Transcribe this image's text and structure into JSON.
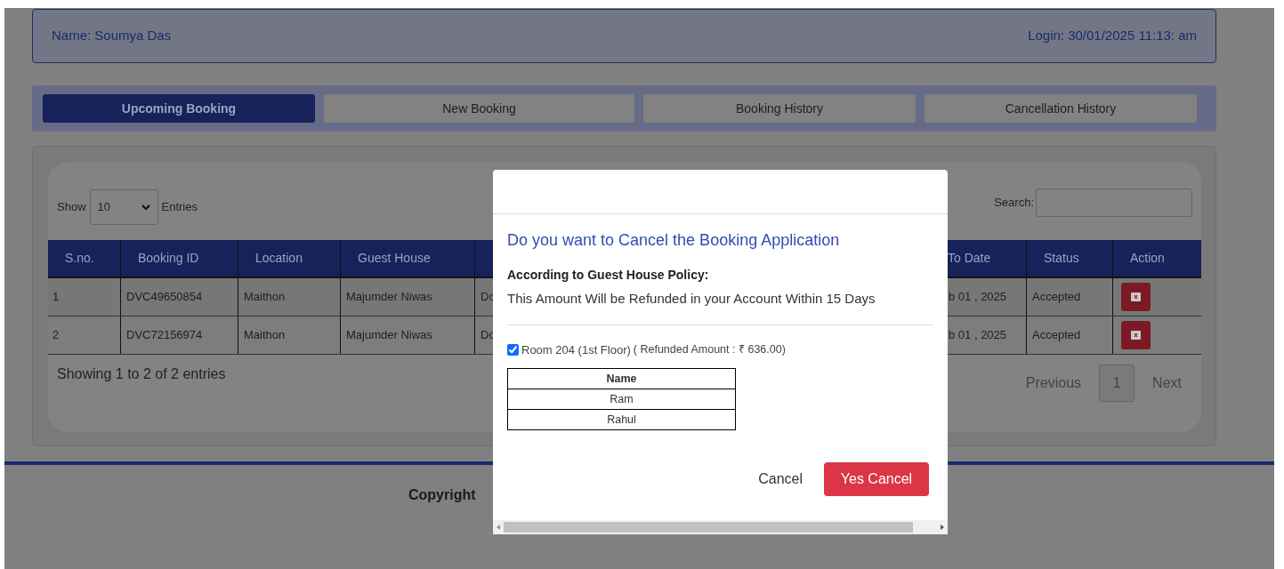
{
  "user_bar": {
    "name": "Name: Soumya Das",
    "login": "Login: 30/01/2025 11:13: am"
  },
  "tabs": [
    {
      "label": "Upcoming Booking",
      "selected": true
    },
    {
      "label": "New Booking",
      "selected": false
    },
    {
      "label": "Booking History",
      "selected": false
    },
    {
      "label": "Cancellation History",
      "selected": false
    }
  ],
  "table_controls": {
    "show_label": "Show",
    "page_size": "10",
    "entries_label": "Entries",
    "search_label": "Search:"
  },
  "table": {
    "columns": [
      "S.no.",
      "Booking ID",
      "Location",
      "Guest House",
      "",
      "To Date",
      "Status",
      "Action"
    ],
    "rows": [
      {
        "cells": [
          "1",
          "DVC49650854",
          "Maithon",
          "Majumder Niwas",
          "Do",
          "b 01 , 2025",
          "Accepted"
        ]
      },
      {
        "cells": [
          "2",
          "DVC72156974",
          "Maithon",
          "Majumder Niwas",
          "Do",
          "b 01 , 2025",
          "Accepted"
        ]
      }
    ]
  },
  "table_footer": {
    "info": "Showing 1 to 2 of 2 entries",
    "previous": "Previous",
    "pages": [
      {
        "label": "1",
        "selected": true
      }
    ],
    "next": "Next"
  },
  "footer": {
    "copyright": "Copyright"
  },
  "modal": {
    "title": "Do you want to Cancel the Booking Application",
    "policy_heading": "According to Guest House Policy:",
    "policy_text": "This Amount Will be Refunded in your Account Within 15 Days",
    "rooms": [
      {
        "label": "Room 204 (1st Floor)",
        "refund": "( Refunded Amount : ₹ 636.00)",
        "checked": true,
        "guests_header": "Name",
        "guests": [
          "Ram",
          "Rahul"
        ]
      }
    ],
    "cancel": "Cancel",
    "confirm": "Yes Cancel"
  }
}
